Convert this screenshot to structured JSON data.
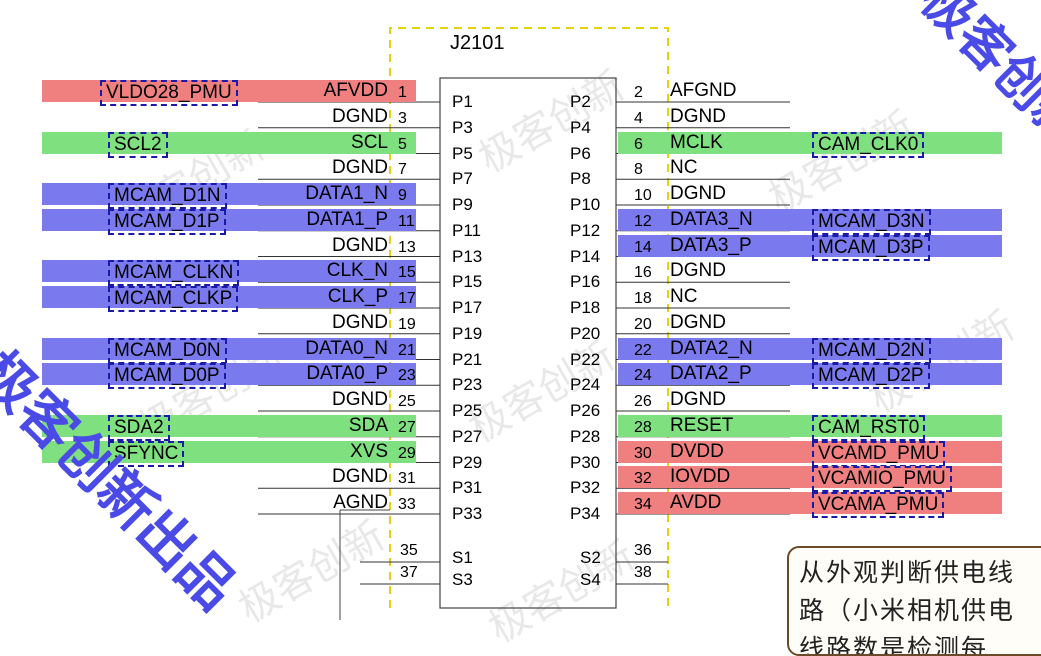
{
  "connector": {
    "ref": "J2101"
  },
  "left_pins": [
    {
      "num": "1",
      "sig": "AFVDD",
      "net": "VLDO28_PMU",
      "color": "red",
      "pad": "P1"
    },
    {
      "num": "3",
      "sig": "DGND",
      "net": "",
      "color": "",
      "pad": "P3"
    },
    {
      "num": "5",
      "sig": "SCL",
      "net": "SCL2",
      "color": "green",
      "pad": "P5"
    },
    {
      "num": "7",
      "sig": "DGND",
      "net": "",
      "color": "",
      "pad": "P7"
    },
    {
      "num": "9",
      "sig": "DATA1_N",
      "net": "MCAM_D1N",
      "color": "blue",
      "pad": "P9"
    },
    {
      "num": "11",
      "sig": "DATA1_P",
      "net": "MCAM_D1P",
      "color": "blue",
      "pad": "P11"
    },
    {
      "num": "13",
      "sig": "DGND",
      "net": "",
      "color": "",
      "pad": "P13"
    },
    {
      "num": "15",
      "sig": "CLK_N",
      "net": "MCAM_CLKN",
      "color": "blue",
      "pad": "P15"
    },
    {
      "num": "17",
      "sig": "CLK_P",
      "net": "MCAM_CLKP",
      "color": "blue",
      "pad": "P17"
    },
    {
      "num": "19",
      "sig": "DGND",
      "net": "",
      "color": "",
      "pad": "P19"
    },
    {
      "num": "21",
      "sig": "DATA0_N",
      "net": "MCAM_D0N",
      "color": "blue",
      "pad": "P21"
    },
    {
      "num": "23",
      "sig": "DATA0_P",
      "net": "MCAM_D0P",
      "color": "blue",
      "pad": "P23"
    },
    {
      "num": "25",
      "sig": "DGND",
      "net": "",
      "color": "",
      "pad": "P25"
    },
    {
      "num": "27",
      "sig": "SDA",
      "net": "SDA2",
      "color": "green",
      "pad": "P27"
    },
    {
      "num": "29",
      "sig": "XVS",
      "net": "SFYNC",
      "color": "green",
      "pad": "P29"
    },
    {
      "num": "31",
      "sig": "DGND",
      "net": "",
      "color": "",
      "pad": "P31"
    },
    {
      "num": "33",
      "sig": "AGND",
      "net": "",
      "color": "",
      "pad": "P33"
    }
  ],
  "right_pins": [
    {
      "num": "2",
      "sig": "AFGND",
      "net": "",
      "color": "",
      "pad": "P2"
    },
    {
      "num": "4",
      "sig": "DGND",
      "net": "",
      "color": "",
      "pad": "P4"
    },
    {
      "num": "6",
      "sig": "MCLK",
      "net": "CAM_CLK0",
      "color": "green",
      "pad": "P6"
    },
    {
      "num": "8",
      "sig": "NC",
      "net": "",
      "color": "",
      "pad": "P8"
    },
    {
      "num": "10",
      "sig": "DGND",
      "net": "",
      "color": "",
      "pad": "P10"
    },
    {
      "num": "12",
      "sig": "DATA3_N",
      "net": "MCAM_D3N",
      "color": "blue",
      "pad": "P12"
    },
    {
      "num": "14",
      "sig": "DATA3_P",
      "net": "MCAM_D3P",
      "color": "blue",
      "pad": "P14"
    },
    {
      "num": "16",
      "sig": "DGND",
      "net": "",
      "color": "",
      "pad": "P16"
    },
    {
      "num": "18",
      "sig": "NC",
      "net": "",
      "color": "",
      "pad": "P18"
    },
    {
      "num": "20",
      "sig": "DGND",
      "net": "",
      "color": "",
      "pad": "P20"
    },
    {
      "num": "22",
      "sig": "DATA2_N",
      "net": "MCAM_D2N",
      "color": "blue",
      "pad": "P22"
    },
    {
      "num": "24",
      "sig": "DATA2_P",
      "net": "MCAM_D2P",
      "color": "blue",
      "pad": "P24"
    },
    {
      "num": "26",
      "sig": "DGND",
      "net": "",
      "color": "",
      "pad": "P26"
    },
    {
      "num": "28",
      "sig": "RESET",
      "net": "CAM_RST0",
      "color": "green",
      "pad": "P28"
    },
    {
      "num": "30",
      "sig": "DVDD",
      "net": "VCAMD_PMU",
      "color": "red",
      "pad": "P30"
    },
    {
      "num": "32",
      "sig": "IOVDD",
      "net": "VCAMIO_PMU",
      "color": "red",
      "pad": "P32"
    },
    {
      "num": "34",
      "sig": "AVDD",
      "net": "VCAMA_PMU",
      "color": "red",
      "pad": "P34"
    }
  ],
  "shield_left": [
    {
      "num": "35",
      "pad": "S1"
    },
    {
      "num": "37",
      "pad": "S3"
    }
  ],
  "shield_right": [
    {
      "num": "36",
      "pad": "S2"
    },
    {
      "num": "38",
      "pad": "S4"
    }
  ],
  "note": {
    "text": "从外观判断供电线\n路（小米相机供电\n线路数是检测每"
  },
  "watermark": {
    "text": "极客创新"
  },
  "stamp": {
    "text": "极客创新出品"
  },
  "colors": {
    "red": "#f08080",
    "green": "#7ee07e",
    "blue": "#7a7aee",
    "net_border": "#1a1aa8",
    "stamp": "#4a4ae6"
  }
}
